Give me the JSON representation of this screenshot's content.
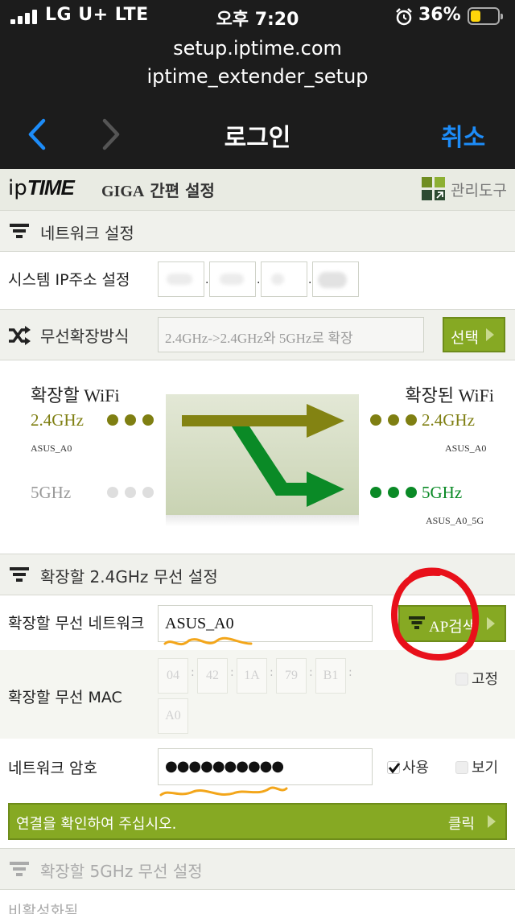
{
  "status": {
    "carrier": "LG U+  LTE",
    "time": "오후 7:20",
    "battery": "36%",
    "battery_fraction": 0.36
  },
  "browser": {
    "url": "setup.iptime.com",
    "page_subtitle": "iptime_extender_setup",
    "title": "로그인",
    "cancel": "취소"
  },
  "header": {
    "logo_small": "ip",
    "logo_big": "TIME",
    "app_title_giga": "GIGA",
    "app_title": "간편 설정",
    "admin_label": "관리도구"
  },
  "network_section": {
    "title": "네트워크 설정"
  },
  "system_ip": {
    "label": "시스템 IP주소 설정",
    "octets": [
      "",
      "",
      "",
      ""
    ]
  },
  "extension_mode": {
    "title": "무선확장방식",
    "value": "2.4GHz->2.4GHz와 5GHz로 확장",
    "select_label": "선택"
  },
  "diagram": {
    "source_title": "확장할 WiFi",
    "target_title": "확장된 WiFi",
    "source_24_label": "2.4GHz",
    "source_24_ssid": "ASUS_A0",
    "source_5_label": "5GHz",
    "target_24_label": "2.4GHz",
    "target_24_ssid": "ASUS_A0",
    "target_5_label": "5GHz",
    "target_5_ssid": "ASUS_A0_5G",
    "colors": {
      "olive": "#7f7f12",
      "green": "#0a8a26",
      "inactive": "#d3d3d3"
    }
  },
  "wifi24_section": {
    "title": "확장할 2.4GHz 무선 설정",
    "network_label": "확장할 무선 네트워크",
    "network_value": "ASUS_A0",
    "ap_search": "AP검색",
    "mac_label": "확장할 무선 MAC",
    "mac_octets": [
      "04",
      "42",
      "1A",
      "79",
      "B1",
      "A0"
    ],
    "fixed_label": "고정",
    "password_label": "네트워크 암호",
    "password_value": "●●●●●●●●●●",
    "use_label": "사용",
    "show_label": "보기",
    "confirm_text": "연결을 확인하여 주십시오.",
    "click_label": "클릭"
  },
  "wifi5_section": {
    "title": "확장할 5GHz 무선 설정",
    "status": "비활성화됨"
  },
  "accent": {
    "green": "#86a923",
    "ios_blue": "#1d8cf8",
    "annotation_red": "#e8101a",
    "annotation_orange": "#f3a61b"
  }
}
